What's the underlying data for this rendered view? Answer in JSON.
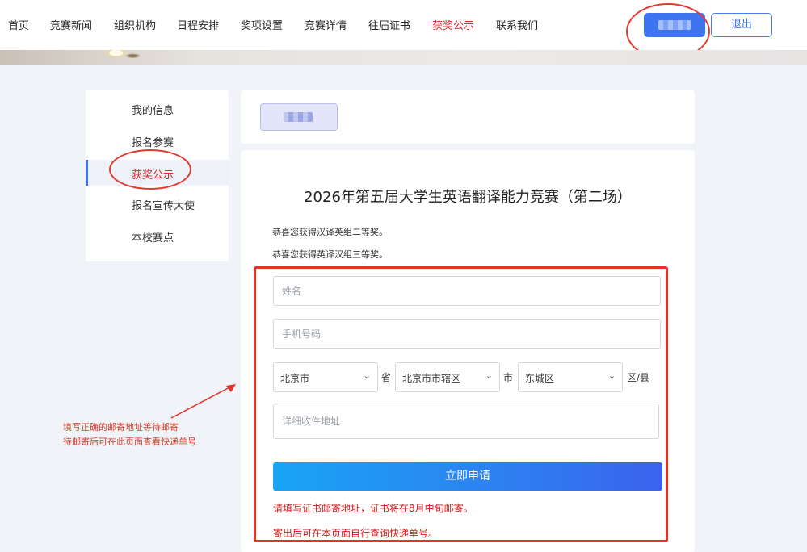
{
  "nav": {
    "items": [
      "首页",
      "竞赛新闻",
      "组织机构",
      "日程安排",
      "奖项设置",
      "竞赛详情",
      "往届证书",
      "获奖公示",
      "联系我们"
    ],
    "active_index": 7,
    "logout_label": "退出"
  },
  "sidebar": {
    "items": [
      "我的信息",
      "报名参赛",
      "获奖公示",
      "报名宣传大使",
      "本校赛点"
    ],
    "active_index": 2
  },
  "contest": {
    "title": "2026年第五届大学生英语翻译能力竞赛（第二场）",
    "awards": [
      "恭喜您获得汉译英组二等奖。",
      "恭喜您获得英译汉组三等奖。"
    ]
  },
  "form": {
    "name_placeholder": "姓名",
    "phone_placeholder": "手机号码",
    "province_value": "北京市",
    "province_suffix": "省",
    "city_value": "北京市市辖区",
    "city_suffix": "市",
    "district_value": "东城区",
    "district_suffix": "区/县",
    "address_placeholder": "详细收件地址",
    "submit_label": "立即申请",
    "notice_1": "请填写证书邮寄地址，证书将在8月中旬邮寄。",
    "notice_2": "寄出后可在本页面自行查询快递单号。"
  },
  "annotation": {
    "line_1": "填写正确的邮寄地址等待邮寄",
    "line_2": "待邮寄后可在此页面查看快递单号"
  },
  "colors": {
    "accent_red": "#e2232a",
    "accent_blue": "#3f74f0",
    "annotation_red": "#e2322a"
  }
}
